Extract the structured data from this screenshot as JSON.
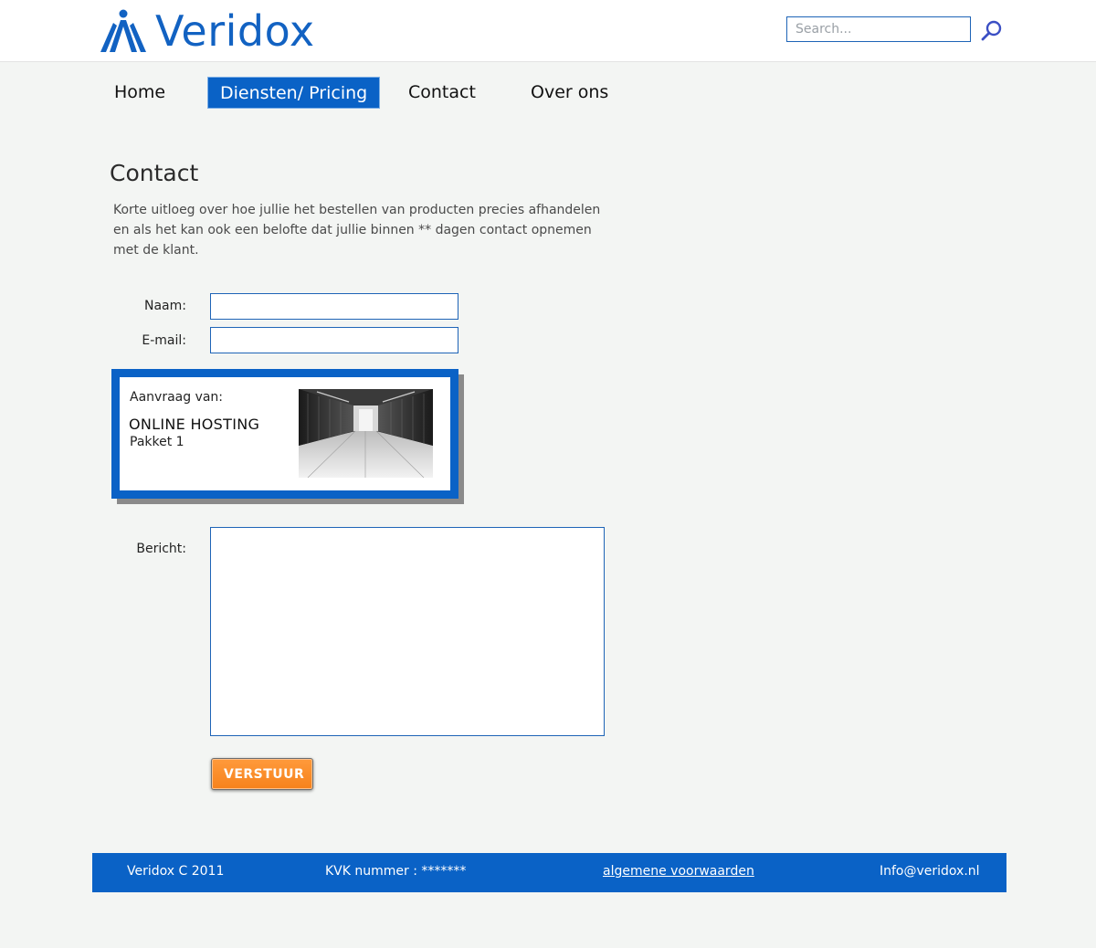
{
  "header": {
    "logo_text": "Veridox",
    "search_placeholder": "Search...",
    "search_icon": "magnifier-icon"
  },
  "nav": {
    "items": [
      {
        "label": "Home",
        "active": false
      },
      {
        "label": "Diensten/ Pricing",
        "active": true
      },
      {
        "label": "Contact",
        "active": false
      },
      {
        "label": "Over ons",
        "active": false
      }
    ]
  },
  "main": {
    "title": "Contact",
    "intro": "Korte uitloeg over hoe jullie het bestellen van producten precies afhandelen en als het kan ook een belofte dat jullie binnen ** dagen contact opnemen met de klant.",
    "form": {
      "name_label": "Naam:",
      "name_value": "",
      "email_label": "E-mail:",
      "email_value": "",
      "message_label": "Bericht:",
      "message_value": "",
      "submit_label": "VERSTUUR"
    },
    "request": {
      "label": "Aanvraag van:",
      "product": "ONLINE HOSTING",
      "package": "Pakket 1",
      "image": "server-room-image"
    }
  },
  "footer": {
    "copyright": "Veridox C 2011",
    "kvk": "KVK nummer : *******",
    "terms_link": "algemene voorwaarden",
    "email": "Info@veridox.nl"
  },
  "colors": {
    "brand_blue": "#0a62c6",
    "button_orange": "#f6821c",
    "page_bg": "#f3f5f3"
  }
}
